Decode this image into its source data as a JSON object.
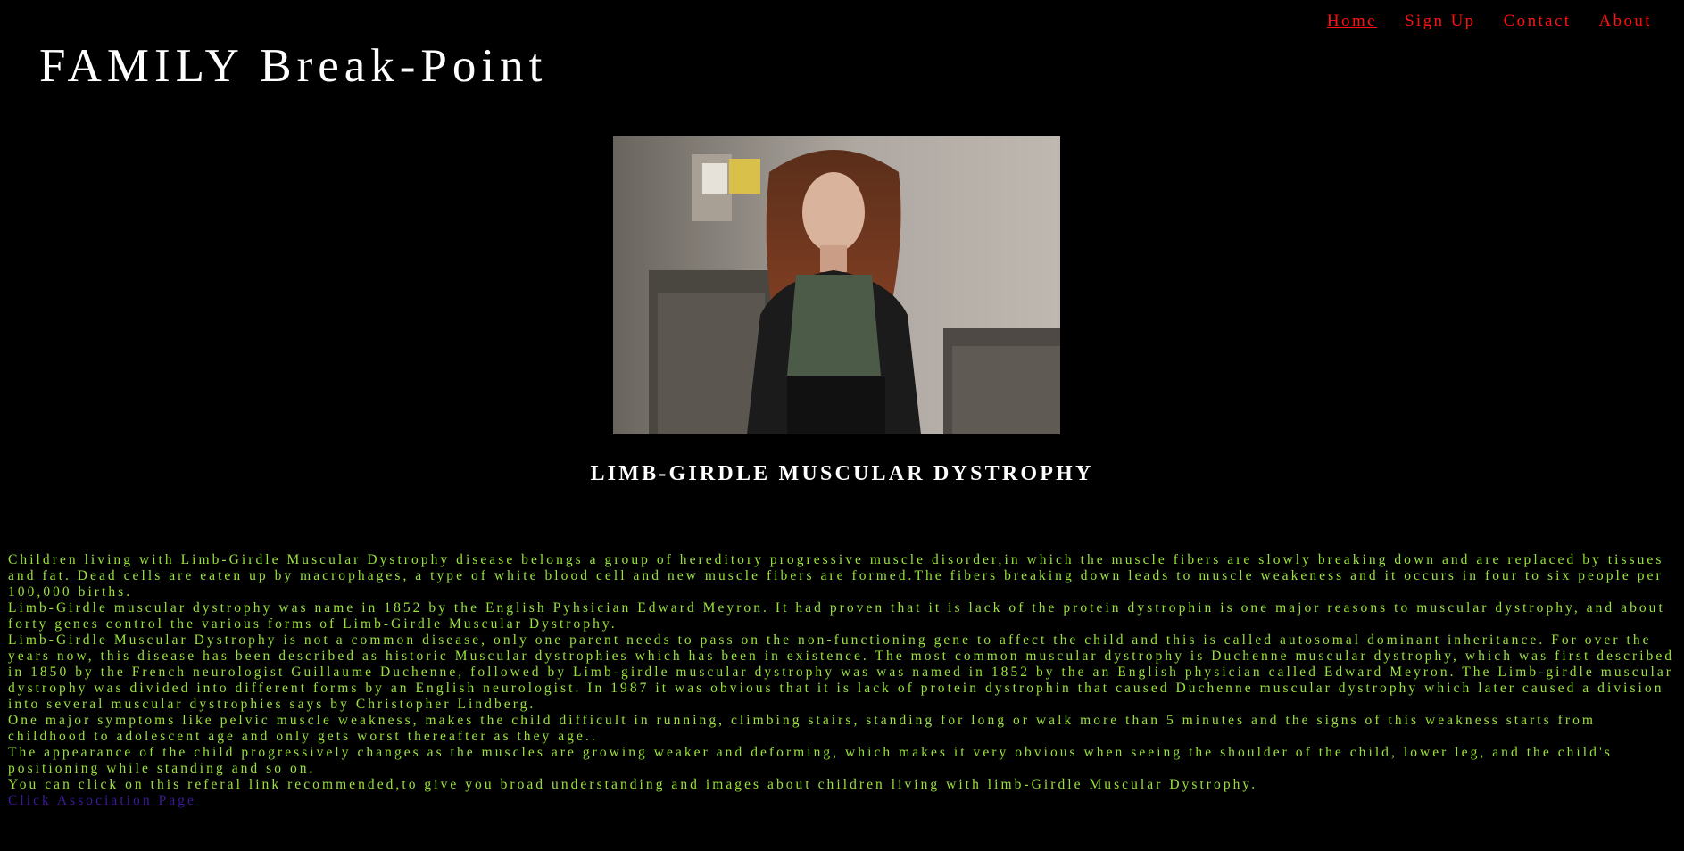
{
  "site": {
    "title": "FAMILY Break-Point"
  },
  "nav": {
    "items": [
      {
        "label": "Home"
      },
      {
        "label": "Sign Up"
      },
      {
        "label": "Contact"
      },
      {
        "label": "About"
      }
    ]
  },
  "article": {
    "heading": "LIMB-GIRDLE MUSCULAR DYSTROPHY",
    "paragraphs": [
      "Children living with Limb-Girdle Muscular Dystrophy disease belongs a group of hereditory progressive muscle disorder,in which the muscle fibers are slowly breaking down and are replaced by tissues and fat. Dead cells are eaten up by macrophages, a type of white blood cell and new muscle fibers are formed.The fibers breaking down leads to muscle weakeness and it occurs in four to six people per 100,000 births.",
      "Limb-Girdle muscular dystrophy was name in 1852 by the English Pyhsician Edward Meyron. It had proven that it is lack of the protein dystrophin is one major reasons to muscular dystrophy, and about forty genes control the various forms of Limb-Girdle Muscular Dystrophy.",
      "Limb-Girdle Muscular Dystrophy is not a common disease, only one parent needs to pass on the non-functioning gene to affect the child and this is called autosomal dominant inheritance. For over the years now, this disease has been described as historic Muscular dystrophies which has been in existence. The most common muscular dystrophy is Duchenne muscular dystrophy, which was first described in 1850 by the French neurologist Guillaume Duchenne, followed by Limb-girdle muscular dystrophy was was named in 1852 by the an English physician called Edward Meyron. The Limb-girdle muscular dystrophy was divided into different forms by an English neurologist. In 1987 it was obvious that it is lack of protein dystrophin that caused Duchenne muscular dystrophy which later caused a division into several muscular dystrophies says by Christopher Lindberg.",
      "One major symptoms like pelvic muscle weakness, makes the child difficult in running, climbing stairs, standing for long or walk more than 5 minutes and the signs of this weakness starts from childhood to adolescent age and only gets worst thereafter as they age..",
      "The appearance of the child progressively changes as the muscles are growing weaker and deforming, which makes it very obvious when seeing the shoulder of the child, lower leg, and the child's positioning while standing and so on.",
      "You can click on this referal link recommended,to give you broad understanding and images about children living with limb-Girdle Muscular Dystrophy."
    ],
    "link_label": "Click Association Page"
  },
  "colors": {
    "background": "#000000",
    "title": "#ffffff",
    "nav_link": "#ff1111",
    "body_text": "#9be33b",
    "link": "#3d1a9a"
  }
}
